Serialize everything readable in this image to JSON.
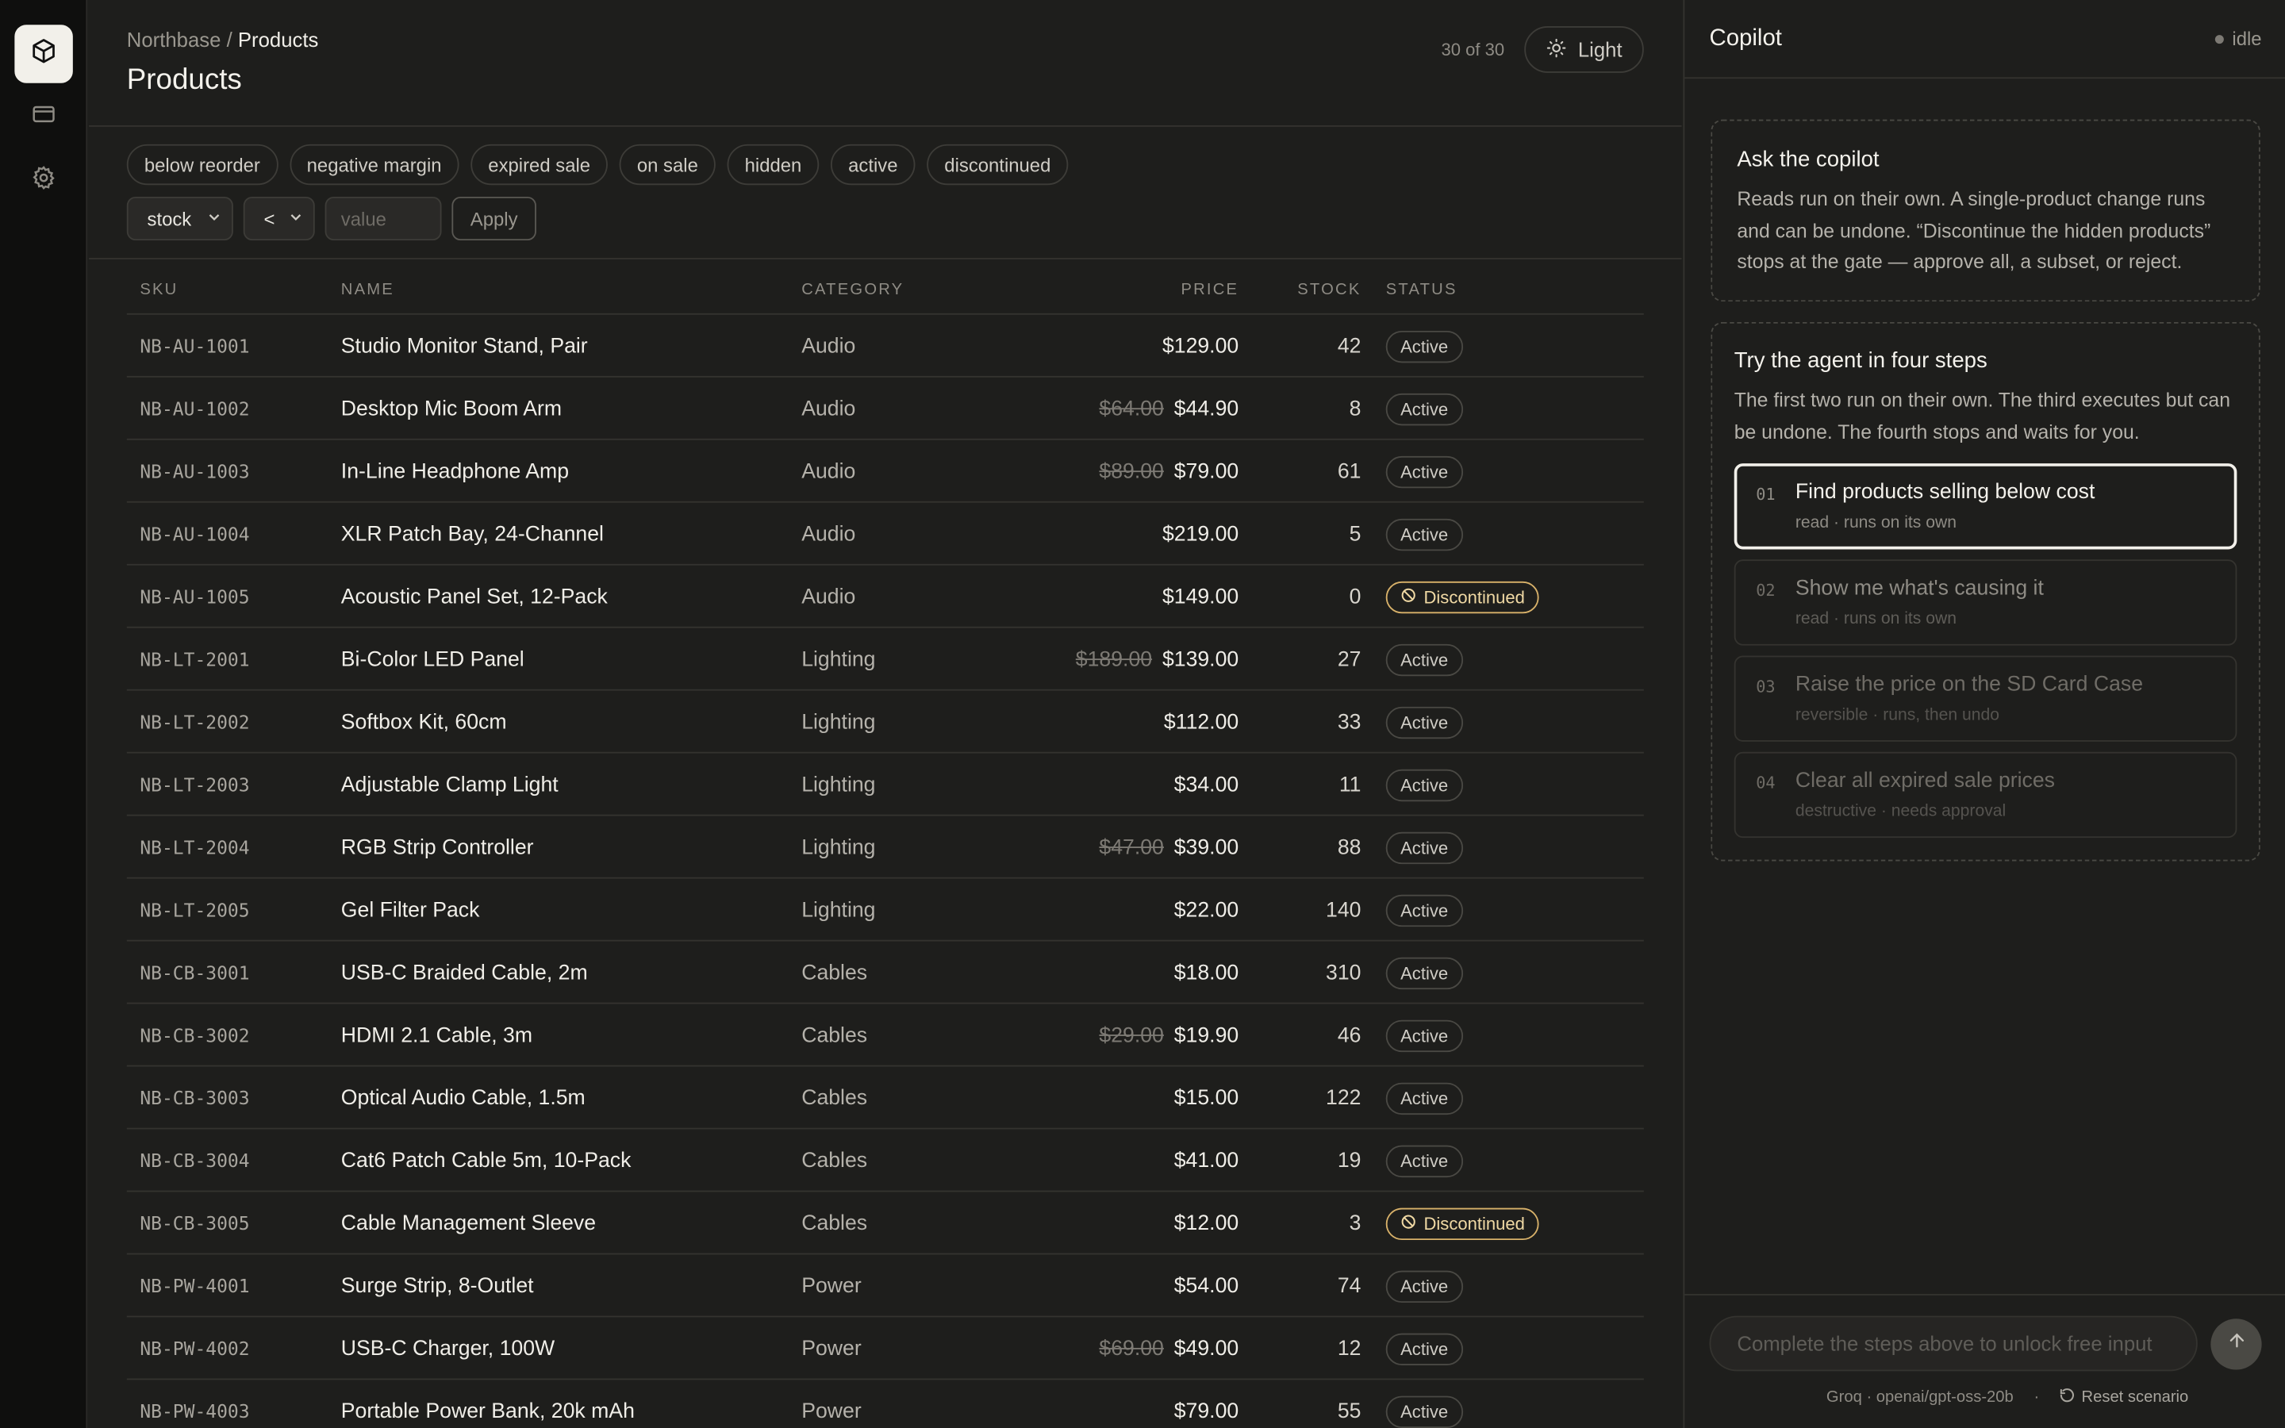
{
  "nav": {
    "items": [
      {
        "name": "products-icon",
        "active": true
      },
      {
        "name": "card-icon",
        "active": false
      },
      {
        "name": "gear-icon",
        "active": false
      }
    ]
  },
  "header": {
    "breadcrumb_root": "Northbase",
    "breadcrumb_sep": "/",
    "breadcrumb_current": "Products",
    "title": "Products",
    "count": "30 of 30",
    "theme_button": "Light",
    "theme_icon": "sun-icon"
  },
  "filters": {
    "chips": [
      "below reorder",
      "negative margin",
      "expired sale",
      "on sale",
      "hidden",
      "active",
      "discontinued"
    ],
    "field_value": "stock",
    "operator_value": "<",
    "value_placeholder": "value",
    "apply_label": "Apply"
  },
  "table": {
    "columns": {
      "sku": "SKU",
      "name": "NAME",
      "category": "CATEGORY",
      "price": "PRICE",
      "stock": "STOCK",
      "status": "STATUS"
    },
    "rows": [
      {
        "sku": "NB-AU-1001",
        "name": "Studio Monitor Stand, Pair",
        "category": "Audio",
        "old_price": "",
        "price": "$129.00",
        "stock": "42",
        "status": "Active"
      },
      {
        "sku": "NB-AU-1002",
        "name": "Desktop Mic Boom Arm",
        "category": "Audio",
        "old_price": "$64.00",
        "price": "$44.90",
        "stock": "8",
        "status": "Active"
      },
      {
        "sku": "NB-AU-1003",
        "name": "In-Line Headphone Amp",
        "category": "Audio",
        "old_price": "$89.00",
        "price": "$79.00",
        "stock": "61",
        "status": "Active"
      },
      {
        "sku": "NB-AU-1004",
        "name": "XLR Patch Bay, 24-Channel",
        "category": "Audio",
        "old_price": "",
        "price": "$219.00",
        "stock": "5",
        "status": "Active"
      },
      {
        "sku": "NB-AU-1005",
        "name": "Acoustic Panel Set, 12-Pack",
        "category": "Audio",
        "old_price": "",
        "price": "$149.00",
        "stock": "0",
        "status": "Discontinued"
      },
      {
        "sku": "NB-LT-2001",
        "name": "Bi-Color LED Panel",
        "category": "Lighting",
        "old_price": "$189.00",
        "price": "$139.00",
        "stock": "27",
        "status": "Active"
      },
      {
        "sku": "NB-LT-2002",
        "name": "Softbox Kit, 60cm",
        "category": "Lighting",
        "old_price": "",
        "price": "$112.00",
        "stock": "33",
        "status": "Active"
      },
      {
        "sku": "NB-LT-2003",
        "name": "Adjustable Clamp Light",
        "category": "Lighting",
        "old_price": "",
        "price": "$34.00",
        "stock": "11",
        "status": "Active"
      },
      {
        "sku": "NB-LT-2004",
        "name": "RGB Strip Controller",
        "category": "Lighting",
        "old_price": "$47.00",
        "price": "$39.00",
        "stock": "88",
        "status": "Active"
      },
      {
        "sku": "NB-LT-2005",
        "name": "Gel Filter Pack",
        "category": "Lighting",
        "old_price": "",
        "price": "$22.00",
        "stock": "140",
        "status": "Active"
      },
      {
        "sku": "NB-CB-3001",
        "name": "USB-C Braided Cable, 2m",
        "category": "Cables",
        "old_price": "",
        "price": "$18.00",
        "stock": "310",
        "status": "Active"
      },
      {
        "sku": "NB-CB-3002",
        "name": "HDMI 2.1 Cable, 3m",
        "category": "Cables",
        "old_price": "$29.00",
        "price": "$19.90",
        "stock": "46",
        "status": "Active"
      },
      {
        "sku": "NB-CB-3003",
        "name": "Optical Audio Cable, 1.5m",
        "category": "Cables",
        "old_price": "",
        "price": "$15.00",
        "stock": "122",
        "status": "Active"
      },
      {
        "sku": "NB-CB-3004",
        "name": "Cat6 Patch Cable 5m, 10-Pack",
        "category": "Cables",
        "old_price": "",
        "price": "$41.00",
        "stock": "19",
        "status": "Active"
      },
      {
        "sku": "NB-CB-3005",
        "name": "Cable Management Sleeve",
        "category": "Cables",
        "old_price": "",
        "price": "$12.00",
        "stock": "3",
        "status": "Discontinued"
      },
      {
        "sku": "NB-PW-4001",
        "name": "Surge Strip, 8-Outlet",
        "category": "Power",
        "old_price": "",
        "price": "$54.00",
        "stock": "74",
        "status": "Active"
      },
      {
        "sku": "NB-PW-4002",
        "name": "USB-C Charger, 100W",
        "category": "Power",
        "old_price": "$69.00",
        "price": "$49.00",
        "stock": "12",
        "status": "Active"
      },
      {
        "sku": "NB-PW-4003",
        "name": "Portable Power Bank, 20k mAh",
        "category": "Power",
        "old_price": "",
        "price": "$79.00",
        "stock": "55",
        "status": "Active"
      }
    ]
  },
  "copilot": {
    "title": "Copilot",
    "state": "idle",
    "ask": {
      "title": "Ask the copilot",
      "body": "Reads run on their own. A single-product change runs and can be undone. “Discontinue the hidden products” stops at the gate — approve all, a subset, or reject."
    },
    "try": {
      "title": "Try the agent in four steps",
      "body": "The first two run on their own. The third executes but can be undone. The fourth stops and waits for you."
    },
    "steps": [
      {
        "num": "01",
        "label": "Find products selling below cost",
        "sub": "read · runs on its own"
      },
      {
        "num": "02",
        "label": "Show me what's causing it",
        "sub": "read · runs on its own"
      },
      {
        "num": "03",
        "label": "Raise the price on the SD Card Case",
        "sub": "reversible · runs, then undo"
      },
      {
        "num": "04",
        "label": "Clear all expired sale prices",
        "sub": "destructive · needs approval"
      }
    ],
    "input_placeholder": "Complete the steps above to unlock free input",
    "model": "Groq · openai/gpt-oss-20b",
    "separator": "·",
    "reset": "Reset scenario"
  },
  "colors": {
    "background": "#1e1e1c",
    "rail": "#0f0f0e",
    "discontinued": "#d9b26a",
    "text": "#f0eee8"
  }
}
